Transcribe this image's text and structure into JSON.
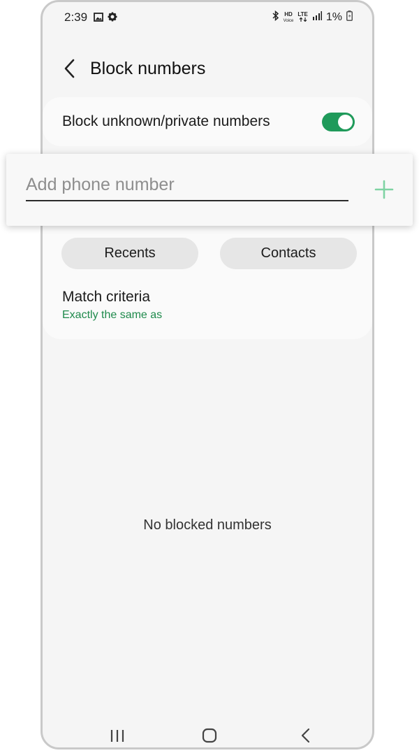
{
  "status_bar": {
    "time": "2:39",
    "left_icons": [
      "image-icon",
      "gear-icon"
    ],
    "right_icons": [
      "bluetooth-icon",
      "hd-voice-icon",
      "lte-icon",
      "signal-icon",
      "battery-charging-icon"
    ],
    "hd_label": "HD",
    "voice_label": "Voice",
    "lte_label": "LTE",
    "battery": "1%"
  },
  "header": {
    "title": "Block numbers"
  },
  "block_unknown": {
    "label": "Block unknown/private numbers",
    "enabled": true
  },
  "add_number": {
    "placeholder": "Add phone number",
    "value": ""
  },
  "buttons": {
    "recents": "Recents",
    "contacts": "Contacts"
  },
  "match_criteria": {
    "title": "Match criteria",
    "value": "Exactly the same as"
  },
  "empty_state": "No blocked numbers",
  "nav_bar": [
    "recent-apps-icon",
    "home-icon",
    "back-icon"
  ],
  "colors": {
    "accent": "#1f9a5a",
    "accent_text": "#1f8a4c",
    "plus": "#7fd3a3"
  }
}
